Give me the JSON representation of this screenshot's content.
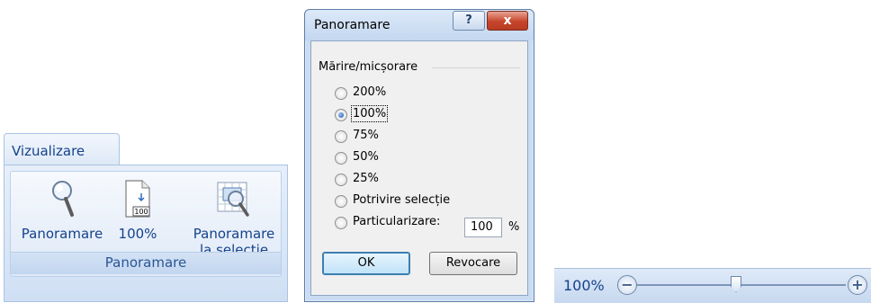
{
  "ribbon": {
    "tab_label": "Vizualizare",
    "buttons": [
      {
        "label": "Panoramare",
        "icon": "magnifier-icon"
      },
      {
        "label": "100%",
        "icon": "page-100-icon"
      },
      {
        "label_line1": "Panoramare",
        "label_line2": "la selecție",
        "icon": "zoom-to-selection-icon"
      }
    ],
    "group_label": "Panoramare",
    "page_icon_text": "100"
  },
  "dialog": {
    "title": "Panoramare",
    "help_glyph": "?",
    "close_glyph": "x",
    "group_label": "Mărire/micșorare",
    "options": [
      {
        "label": "200%",
        "selected": false
      },
      {
        "label": "100%",
        "selected": true
      },
      {
        "label": "75%",
        "selected": false
      },
      {
        "label": "50%",
        "selected": false
      },
      {
        "label": "25%",
        "selected": false
      },
      {
        "label": "Potrivire selecție",
        "selected": false
      },
      {
        "label": "Particularizare:",
        "selected": false
      }
    ],
    "custom_value": "100",
    "percent_sign": "%",
    "ok_label": "OK",
    "cancel_label": "Revocare"
  },
  "statusbar": {
    "zoom_level": "100%",
    "minus_glyph": "−",
    "plus_glyph": "+"
  },
  "colors": {
    "ribbon_text": "#15428b",
    "dialog_bg": "#f0f0f0",
    "close_button": "#c6452c"
  }
}
